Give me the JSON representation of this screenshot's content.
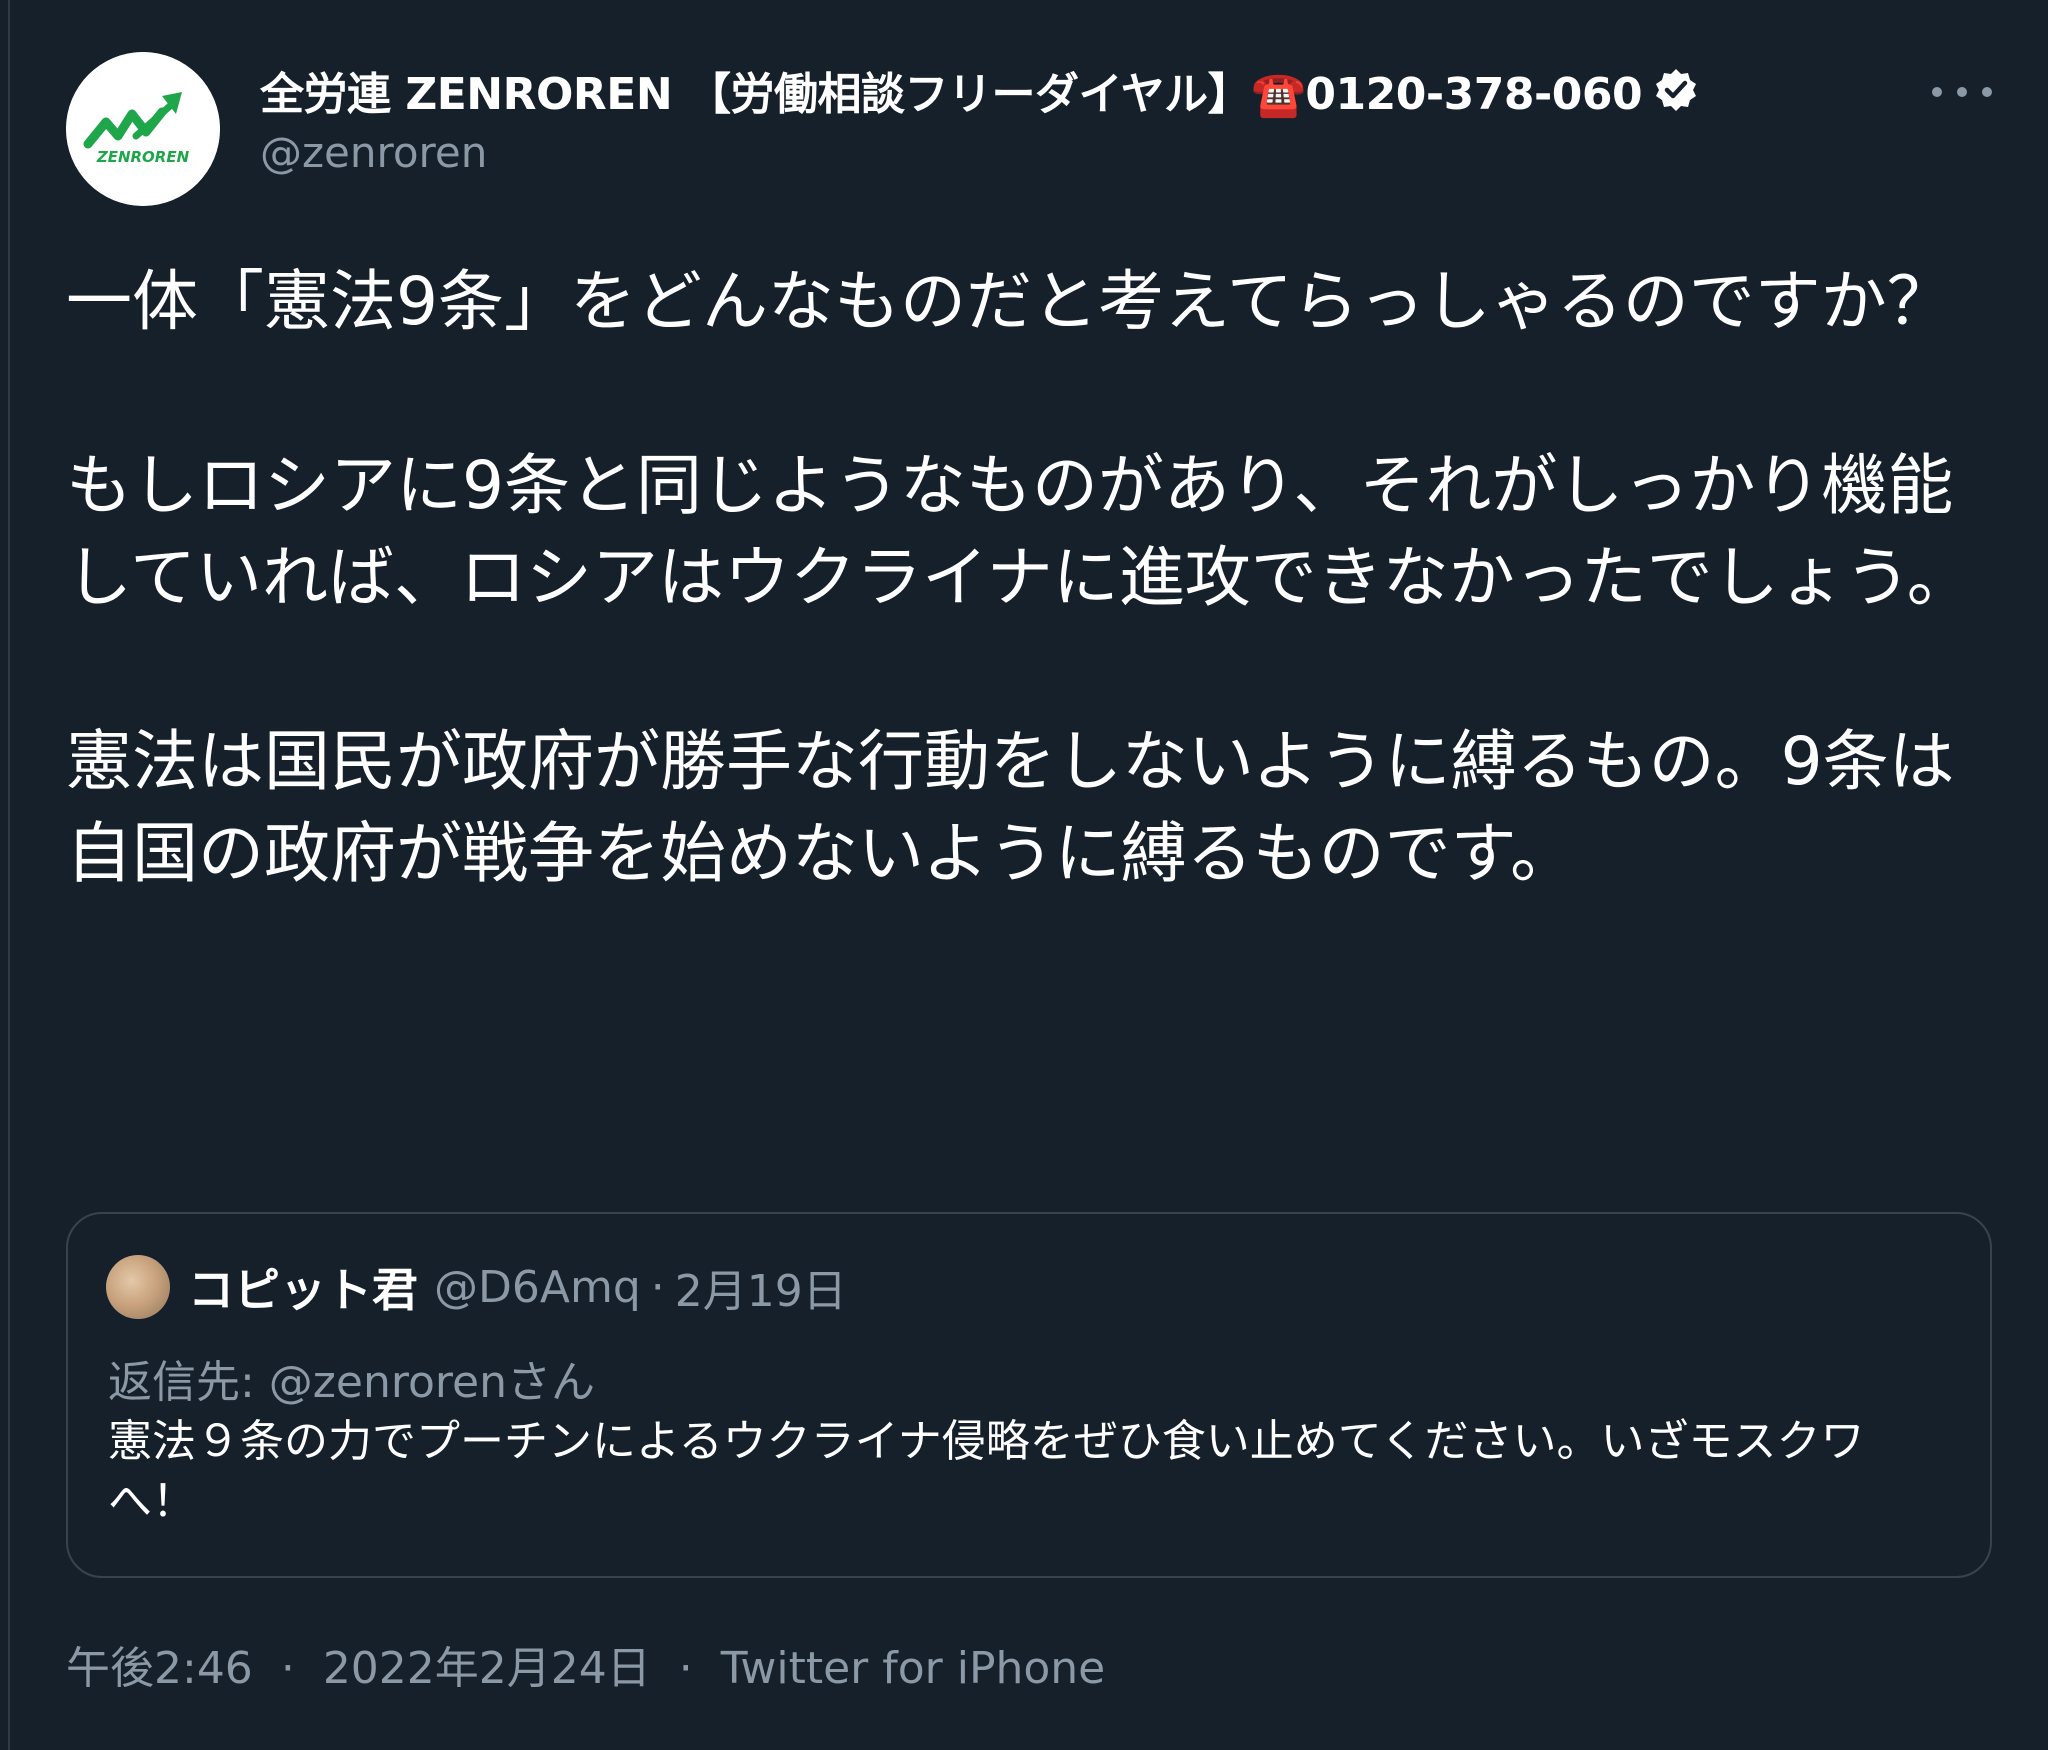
{
  "tweet": {
    "author": {
      "display_name": "全労連 ZENROREN 【労働相談フリーダイヤル】☎️0120-378-060",
      "handle": "@zenroren",
      "avatar_logo_text": "ZENROREN",
      "verified": true
    },
    "body": {
      "paragraphs": [
        "一体「憲法9条」をどんなものだと考えてらっしゃるのですか？",
        "もしロシアに9条と同じようなものがあり、それがしっかり機能していれば、ロシアはウクライナに進攻できなかったでしょう。",
        "憲法は国民が政府が勝手な行動をしないように縛るもの。9条は自国の政府が戦争を始めないように縛るものです。"
      ]
    },
    "quoted_tweet": {
      "display_name": "コピット君",
      "handle": "@D6Amq",
      "date": "2月19日",
      "separator": "·",
      "reply_to": "返信先: @zenrorenさん",
      "text": "憲法９条の力でプーチンによるウクライナ侵略をぜひ食い止めてください。いざモスクワへ！"
    },
    "footer": {
      "time": "午後2:46",
      "date": "2022年2月24日",
      "source": "Twitter for iPhone",
      "separator": "·"
    }
  },
  "icons": {
    "more": "more-horizontal-icon",
    "verified": "verified-badge-icon"
  },
  "colors": {
    "background": "#15202b",
    "text_primary": "#ffffff",
    "text_secondary": "#8b98a5",
    "border": "#38444d",
    "logo_green": "#1fa64a"
  }
}
